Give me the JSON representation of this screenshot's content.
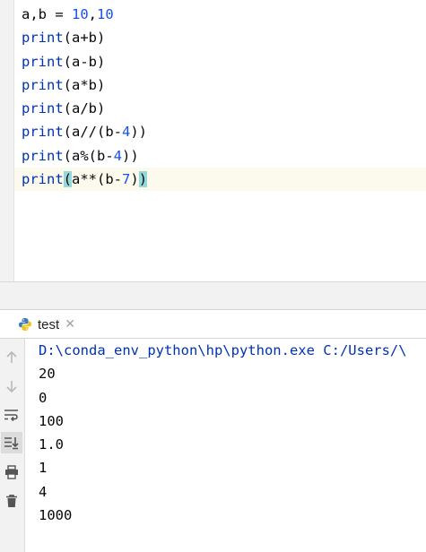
{
  "editor": {
    "lines": [
      [
        {
          "t": "a,b = ",
          "c": ""
        },
        {
          "t": "10",
          "c": "num"
        },
        {
          "t": ",",
          "c": ""
        },
        {
          "t": "10",
          "c": "num"
        }
      ],
      [
        {
          "t": "print",
          "c": "kw"
        },
        {
          "t": "(a+b)",
          "c": ""
        }
      ],
      [
        {
          "t": "print",
          "c": "kw"
        },
        {
          "t": "(a-b)",
          "c": ""
        }
      ],
      [
        {
          "t": "print",
          "c": "kw"
        },
        {
          "t": "(a*b)",
          "c": ""
        }
      ],
      [
        {
          "t": "print",
          "c": "kw"
        },
        {
          "t": "(a/b)",
          "c": ""
        }
      ],
      [
        {
          "t": "print",
          "c": "kw"
        },
        {
          "t": "(a//(b-",
          "c": ""
        },
        {
          "t": "4",
          "c": "num"
        },
        {
          "t": "))",
          "c": ""
        }
      ],
      [
        {
          "t": "print",
          "c": "kw"
        },
        {
          "t": "(a%(b-",
          "c": ""
        },
        {
          "t": "4",
          "c": "num"
        },
        {
          "t": "))",
          "c": ""
        }
      ],
      [
        {
          "t": "print",
          "c": "kw"
        },
        {
          "t": "(",
          "c": "hl"
        },
        {
          "t": "a**(b-",
          "c": ""
        },
        {
          "t": "7",
          "c": "num"
        },
        {
          "t": ")",
          "c": ""
        },
        {
          "t": ")",
          "c": "hl"
        }
      ]
    ],
    "current_line": 7
  },
  "run": {
    "tab_label": "test",
    "tab_icon": "python-icon",
    "close_icon": "close-icon",
    "toolbar_icons": [
      "arrow-up-icon",
      "arrow-down-icon",
      "soft-wrap-icon",
      "scroll-to-end-icon",
      "print-icon",
      "trash-icon"
    ],
    "output": [
      "D:\\conda_env_python\\hp\\python.exe C:/Users/\\",
      "20",
      "0",
      "100",
      "1.0",
      "1",
      "4",
      "1000"
    ]
  },
  "colors": {
    "keyword": "#0033b3",
    "number": "#1750eb",
    "brace_highlight": "#93d9d9",
    "current_line": "#fcfaed"
  }
}
